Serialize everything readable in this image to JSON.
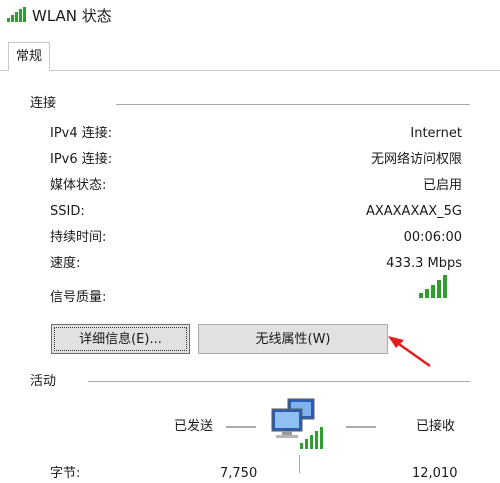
{
  "window": {
    "title": "WLAN 状态",
    "icon": "wifi-signal-icon"
  },
  "tabs": [
    {
      "label": "常规",
      "selected": true
    }
  ],
  "connection": {
    "section_label": "连接",
    "rows": [
      {
        "label": "IPv4 连接:",
        "value": "Internet"
      },
      {
        "label": "IPv6 连接:",
        "value": "无网络访问权限"
      },
      {
        "label": "媒体状态:",
        "value": "已启用"
      },
      {
        "label": "SSID:",
        "value": "AXAXAXAX_5G"
      },
      {
        "label": "持续时间:",
        "value": "00:06:00"
      },
      {
        "label": "速度:",
        "value": "433.3 Mbps"
      }
    ],
    "signal_label": "信号质量:",
    "signal_icon": "signal-strength-icon",
    "signal_color": "#2e9e2e"
  },
  "buttons": {
    "details_label": "详细信息(E)...",
    "wireless_props_label": "无线属性(W)"
  },
  "annotation": {
    "arrow_color": "#e02020"
  },
  "activity": {
    "section_label": "活动",
    "sent_label": "已发送",
    "received_label": "已接收",
    "network_icon": "network-computers-icon",
    "bytes_label": "字节:",
    "bytes_sent": "7,750",
    "bytes_received": "12,010"
  }
}
